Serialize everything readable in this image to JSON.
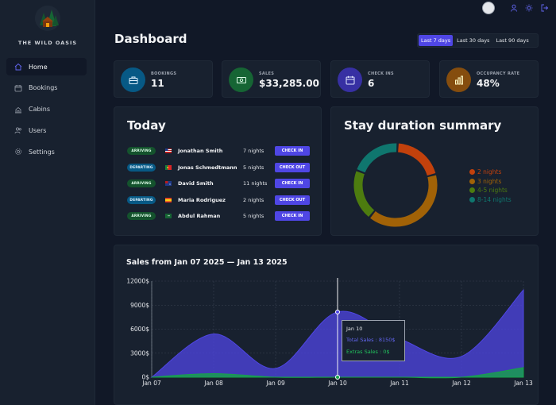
{
  "app": {
    "name": "THE WILD OASIS"
  },
  "sidebar": {
    "items": [
      {
        "label": "Home",
        "icon": "home-icon",
        "active": true
      },
      {
        "label": "Bookings",
        "icon": "calendar-icon",
        "active": false
      },
      {
        "label": "Cabins",
        "icon": "cabin-icon",
        "active": false
      },
      {
        "label": "Users",
        "icon": "users-icon",
        "active": false
      },
      {
        "label": "Settings",
        "icon": "gear-icon",
        "active": false
      }
    ]
  },
  "header": {
    "icons": [
      "avatar",
      "user-icon",
      "sun-icon",
      "logout-icon"
    ]
  },
  "page": {
    "title": "Dashboard"
  },
  "filter": {
    "options": [
      "Last 7 days",
      "Last 30 days",
      "Last 90 days"
    ],
    "selected": "Last 7 days"
  },
  "stats": [
    {
      "label": "BOOKINGS",
      "value": "11",
      "icon": "briefcase-icon",
      "color": "#075985"
    },
    {
      "label": "SALES",
      "value": "$33,285.00",
      "icon": "banknotes-icon",
      "color": "#166534"
    },
    {
      "label": "CHECK INS",
      "value": "6",
      "icon": "calendar-days-icon",
      "color": "#3730a3"
    },
    {
      "label": "OCCUPANCY RATE",
      "value": "48%",
      "icon": "chart-bar-icon",
      "color": "#854d0e"
    }
  ],
  "today": {
    "title": "Today",
    "rows": [
      {
        "status": "ARRIVING",
        "guest": "Jonathan Smith",
        "nights": "7 nights",
        "action": "CHECK IN"
      },
      {
        "status": "DEPARTING",
        "guest": "Jonas Schmedtmann",
        "nights": "5 nights",
        "action": "CHECK OUT"
      },
      {
        "status": "ARRIVING",
        "guest": "David Smith",
        "nights": "11 nights",
        "action": "CHECK IN"
      },
      {
        "status": "DEPARTING",
        "guest": "Maria Rodriguez",
        "nights": "2 nights",
        "action": "CHECK OUT"
      },
      {
        "status": "ARRIVING",
        "guest": "Abdul Rahman",
        "nights": "5 nights",
        "action": "CHECK IN"
      }
    ]
  },
  "duration": {
    "title": "Stay duration summary",
    "legend": [
      {
        "label": "2 nights",
        "color": "#c2410c"
      },
      {
        "label": "3 nights",
        "color": "#a16207"
      },
      {
        "label": "4-5 nights",
        "color": "#4d7c0f"
      },
      {
        "label": "8-14 nights",
        "color": "#0f766e"
      }
    ]
  },
  "sales": {
    "title": "Sales from Jan 07 2025 — Jan 13 2025",
    "tooltip": {
      "date": "Jan 10",
      "total": "Total Sales : 8150$",
      "extras": "Extras Sales : 0$"
    }
  },
  "chart_data": [
    {
      "type": "pie",
      "title": "Stay duration summary",
      "style": "donut",
      "categories": [
        "2 nights",
        "3 nights",
        "4-5 nights",
        "8-14 nights"
      ],
      "values": [
        2,
        4,
        2,
        2
      ],
      "colors": [
        "#c2410c",
        "#a16207",
        "#4d7c0f",
        "#0f766e"
      ],
      "legend": "right"
    },
    {
      "type": "area",
      "title": "Sales from Jan 07 2025 — Jan 13 2025",
      "categories": [
        "Jan 07",
        "Jan 08",
        "Jan 09",
        "Jan 10",
        "Jan 11",
        "Jan 12",
        "Jan 13"
      ],
      "yticks": [
        "0$",
        "3000$",
        "6000$",
        "9000$",
        "12000$"
      ],
      "ylim": [
        0,
        12000
      ],
      "grid": true,
      "series": [
        {
          "name": "Total Sales",
          "values": [
            0,
            5400,
            1100,
            8150,
            4800,
            2600,
            10900
          ],
          "color": "#4f46e5"
        },
        {
          "name": "Extras Sales",
          "values": [
            0,
            450,
            0,
            0,
            0,
            0,
            1200
          ],
          "color": "#16a34a"
        }
      ]
    }
  ]
}
